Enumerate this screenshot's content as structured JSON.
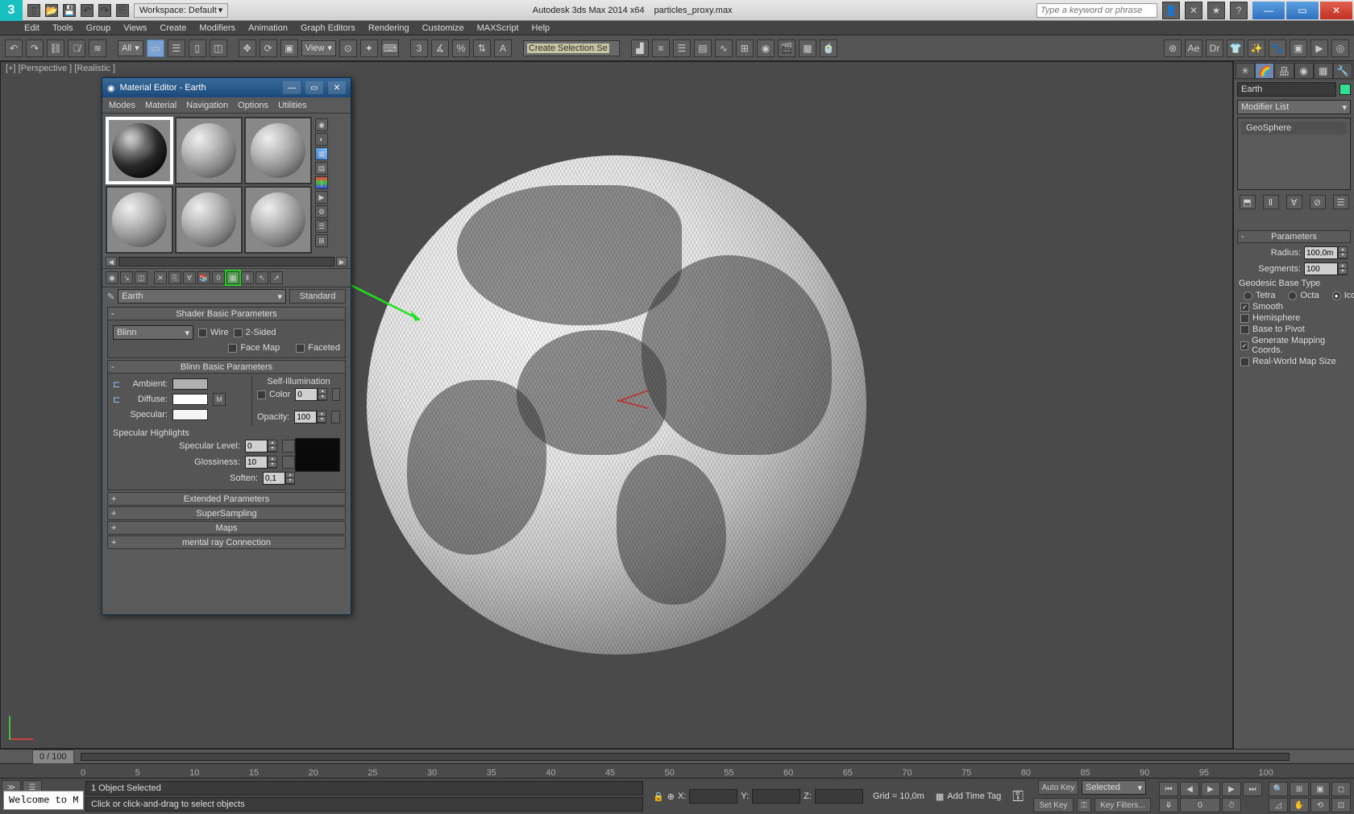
{
  "titlebar": {
    "workspace_label": "Workspace: Default",
    "app": "Autodesk 3ds Max 2014 x64",
    "file": "particles_proxy.max",
    "search_placeholder": "Type a keyword or phrase"
  },
  "menu": [
    "Edit",
    "Tools",
    "Group",
    "Views",
    "Create",
    "Modifiers",
    "Animation",
    "Graph Editors",
    "Rendering",
    "Customize",
    "MAXScript",
    "Help"
  ],
  "toolbar": {
    "filter": "All",
    "view_label": "View",
    "sel_placeholder": "Create Selection Se"
  },
  "viewport": {
    "label": "[+] [Perspective ] [Realistic ]"
  },
  "cmdpanel": {
    "object_name": "Earth",
    "modifier_list": "Modifier List",
    "stack_item": "GeoSphere",
    "rollout": "Parameters",
    "radius_label": "Radius:",
    "radius": "100,0m",
    "segments_label": "Segments:",
    "segments": "100",
    "geo_label": "Geodesic Base Type",
    "geo_opts": [
      "Tetra",
      "Octa",
      "Icosa"
    ],
    "smooth": "Smooth",
    "hemisphere": "Hemisphere",
    "base_pivot": "Base to Pivot",
    "gen_map": "Generate Mapping Coords.",
    "real_world": "Real-World Map Size"
  },
  "bottom": {
    "frame": "0 / 100",
    "ticks": [
      "0",
      "5",
      "10",
      "15",
      "20",
      "25",
      "30",
      "35",
      "40",
      "45",
      "50",
      "55",
      "60",
      "65",
      "70",
      "75",
      "80",
      "85",
      "90",
      "95",
      "100"
    ],
    "selected": "1 Object Selected",
    "prompt": "Click or click-and-drag to select objects",
    "x": "X:",
    "y": "Y:",
    "z": "Z:",
    "grid": "Grid = 10,0m",
    "add_tag": "Add Time Tag",
    "autokey": "Auto Key",
    "setkey": "Set Key",
    "selected_dd": "Selected",
    "keyfilters": "Key Filters...",
    "welcome": "Welcome to M"
  },
  "material": {
    "title": "Material Editor - Earth",
    "menu": [
      "Modes",
      "Material",
      "Navigation",
      "Options",
      "Utilities"
    ],
    "name": "Earth",
    "type": "Standard",
    "shader_roll": "Shader Basic Parameters",
    "shader": "Blinn",
    "wire": "Wire",
    "twosided": "2-Sided",
    "facemap": "Face Map",
    "faceted": "Faceted",
    "blinn_roll": "Blinn Basic Parameters",
    "selfillum": "Self-Illumination",
    "color_chk": "Color",
    "color_v": "0",
    "ambient": "Ambient:",
    "diffuse": "Diffuse:",
    "specular": "Specular:",
    "m": "M",
    "opacity": "Opacity:",
    "opacity_v": "100",
    "spechi": "Specular Highlights",
    "speclvl": "Specular Level:",
    "speclvl_v": "0",
    "gloss": "Glossiness:",
    "gloss_v": "10",
    "soften": "Soften:",
    "soften_v": "0,1",
    "ext": "Extended Parameters",
    "ss": "SuperSampling",
    "maps": "Maps",
    "mr": "mental ray Connection"
  }
}
